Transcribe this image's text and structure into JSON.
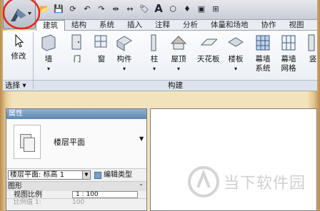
{
  "quick_access": {
    "icons": [
      "open-icon",
      "save-icon",
      "sync-icon",
      "undo-icon",
      "redo-icon",
      "measure-icon",
      "dimension-icon",
      "tag-icon",
      "text-icon",
      "3d-view-icon",
      "section-icon",
      "switch-windows-icon",
      "close-hidden-icon"
    ],
    "text_glyph": "A"
  },
  "tabs": [
    "建筑",
    "结构",
    "系统",
    "插入",
    "注释",
    "分析",
    "体量和场地",
    "协作",
    "视图"
  ],
  "ribbon": {
    "modify_label": "修改",
    "select_group_label": "选择",
    "build_group_label": "构建",
    "buttons": [
      {
        "label": "墙",
        "arrow": "▾"
      },
      {
        "label": "门",
        "arrow": ""
      },
      {
        "label": "窗",
        "arrow": ""
      },
      {
        "label": "构件",
        "arrow": "▾"
      },
      {
        "label": "柱",
        "arrow": "▾"
      },
      {
        "label": "屋顶",
        "arrow": "▾"
      },
      {
        "label": "天花板",
        "arrow": ""
      },
      {
        "label": "楼板",
        "arrow": "▾"
      },
      {
        "label": "幕墙\n系统",
        "arrow": ""
      },
      {
        "label": "幕墙\n网格",
        "arrow": ""
      },
      {
        "label": "竖",
        "arrow": ""
      }
    ]
  },
  "properties": {
    "title": "属性",
    "type_name": "楼层平面",
    "selector_value": "楼层平面: 标高 1",
    "edit_type_label": "编辑类型",
    "section_label": "图形",
    "rows": [
      {
        "key": "视图比例",
        "value": "1 : 100"
      },
      {
        "key": "比例值 1:",
        "value": "100"
      }
    ]
  },
  "watermark": {
    "text": "当下软件园"
  },
  "colors": {
    "ribbon_bg": "#eef2f7",
    "panel_title": "#6d93bc",
    "annotation_circle": "#e8221b"
  }
}
